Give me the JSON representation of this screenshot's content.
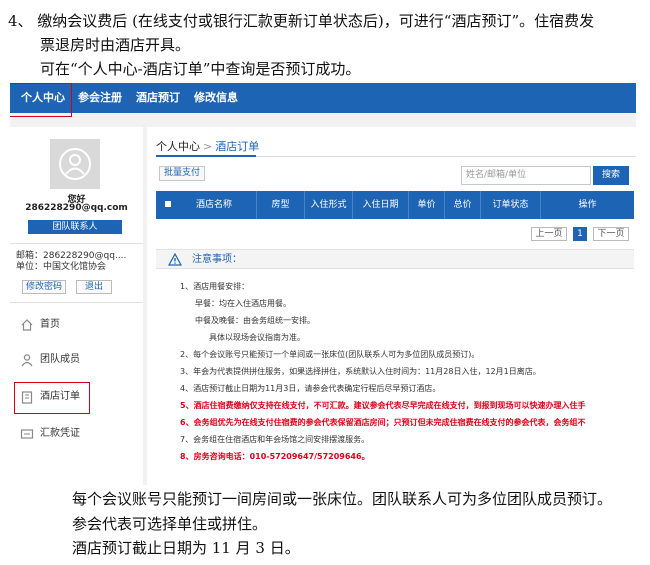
{
  "doc": {
    "intro": [
      "4、 缴纳会议费后 (在线支付或银行汇款更新订单状态后)，可进行“酒店预订”。住宿费发",
      "票退房时由酒店开具。",
      "可在“个人中心-酒店订单”中查询是否预订成功。"
    ],
    "outro": [
      "每个会议账号只能预订一间房间或一张床位。团队联系人可为多位团队成员预订。",
      "参会代表可选择单住或拼住。",
      "酒店预订截止日期为 11 月 3 日。"
    ]
  },
  "nav": [
    "个人中心",
    "参会注册",
    "酒店预订",
    "修改信息"
  ],
  "sidebar": {
    "greeting": "您好",
    "email_display": "286228290@qq.com",
    "team_button": "团队联系人",
    "email_line": "邮箱：286228290@qq....",
    "unit_line": "单位：中国文化馆协会",
    "change_pwd": "修改密码",
    "logout": "退出",
    "menu": [
      "首页",
      "团队成员",
      "酒店订单",
      "汇款凭证"
    ]
  },
  "main": {
    "crumb_root": "个人中心",
    "crumb_sep": ">",
    "crumb_current": "酒店订单",
    "batch_pay": "批量支付",
    "search_placeholder": "姓名/邮箱/单位",
    "search_button": "搜索",
    "columns": [
      "酒店名称",
      "房型",
      "入住形式",
      "入住日期",
      "单价",
      "总价",
      "订单状态",
      "操作"
    ],
    "pager": {
      "prev": "上一页",
      "current": "1",
      "next": "下一页"
    },
    "notice_title": "注意事项：",
    "notes": [
      "1、酒店用餐安排：",
      "早餐：均在入住酒店用餐。",
      "中餐及晚餐：由会务组统一安排。",
      "具体以现场会议指南为准。",
      "2、每个会议账号只能预订一个单间或一张床位(团队联系人可为多位团队成员预订)。",
      "3、年会为代表提供拼住服务，如果选择拼住，系统默认入住时间为：11月28日入住，12月1日离店。",
      "4、酒店预订截止日期为11月3日，请参会代表确定行程后尽早预订酒店。",
      "5、酒店住宿费缴纳仅支持在线支付，不可汇款。建议参会代表尽早完成在线支付，到报到现场可以快速办理入住手",
      "6、会务组优先为在线支付住宿费的参会代表保留酒店房间；只预订但未完成住宿费在线支付的参会代表，会务组不",
      "7、会务组在住宿酒店和年会场馆之间安排摆渡服务。",
      "8、房务咨询电话：010-57209647/57209646。"
    ]
  }
}
